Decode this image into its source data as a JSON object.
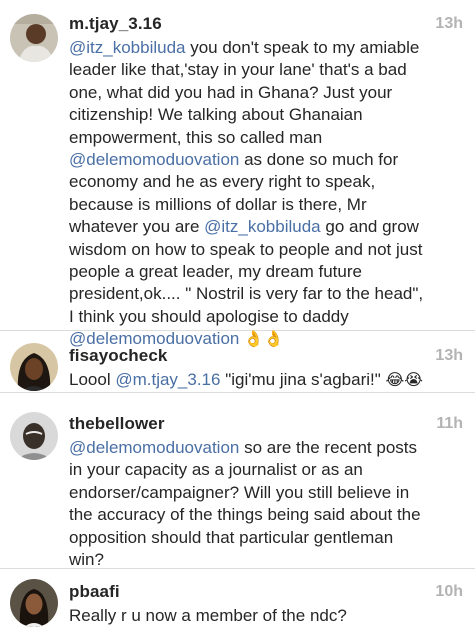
{
  "comments": [
    {
      "username": "m.tjay_3.16",
      "time": "13h",
      "lines": [
        [
          {
            "m": "@itz_kobbiluda"
          },
          {
            "t": " you don't speak to my amiable"
          }
        ],
        [
          {
            "t": "leader like that,'stay in your lane' that's a bad"
          }
        ],
        [
          {
            "t": "one, what did you had in Ghana? Just your"
          }
        ],
        [
          {
            "t": "citizenship!  We talking about Ghanaian"
          }
        ],
        [
          {
            "t": "empowerment,  this so called man"
          }
        ],
        [
          {
            "m": "@delemomoduovation"
          },
          {
            "t": "  as done so much for"
          }
        ],
        [
          {
            "t": "economy and he as every right to speak,"
          }
        ],
        [
          {
            "t": "because is millions of dollar is there, Mr"
          }
        ],
        [
          {
            "t": "whatever you are "
          },
          {
            "m": "@itz_kobbiluda"
          },
          {
            "t": " go and grow"
          }
        ],
        [
          {
            "t": "wisdom on how to speak to people and not just"
          }
        ],
        [
          {
            "t": "people a great leader, my dream future"
          }
        ],
        [
          {
            "t": "president,ok.... \" Nostril is very far to the head\","
          }
        ],
        [
          {
            "t": "I think you should apologise to daddy"
          }
        ],
        [
          {
            "m": "@delemomoduovation"
          },
          {
            "e": " 👌👌"
          }
        ]
      ]
    },
    {
      "username": "fisayocheck",
      "time": "13h",
      "lines": [
        [
          {
            "t": "Loool "
          },
          {
            "m": "@m.tjay_3.16"
          },
          {
            "t": " \"igi'mu jina s'agbari!\" "
          },
          {
            "e": "😂😭"
          }
        ]
      ]
    },
    {
      "username": "thebellower",
      "time": "11h",
      "lines": [
        [
          {
            "m": "@delemomoduovation"
          },
          {
            "t": " so are the recent posts"
          }
        ],
        [
          {
            "t": "in your capacity as a journalist or as an"
          }
        ],
        [
          {
            "t": "endorser/campaigner?  Will you still believe in"
          }
        ],
        [
          {
            "t": "the accuracy of the things being said about the"
          }
        ],
        [
          {
            "t": "opposition should that particular gentleman"
          }
        ],
        [
          {
            "t": "win?"
          }
        ]
      ]
    },
    {
      "username": "pbaafi",
      "time": "10h",
      "lines": [
        [
          {
            "t": "Really r u now a member of the ndc?"
          }
        ]
      ]
    }
  ]
}
